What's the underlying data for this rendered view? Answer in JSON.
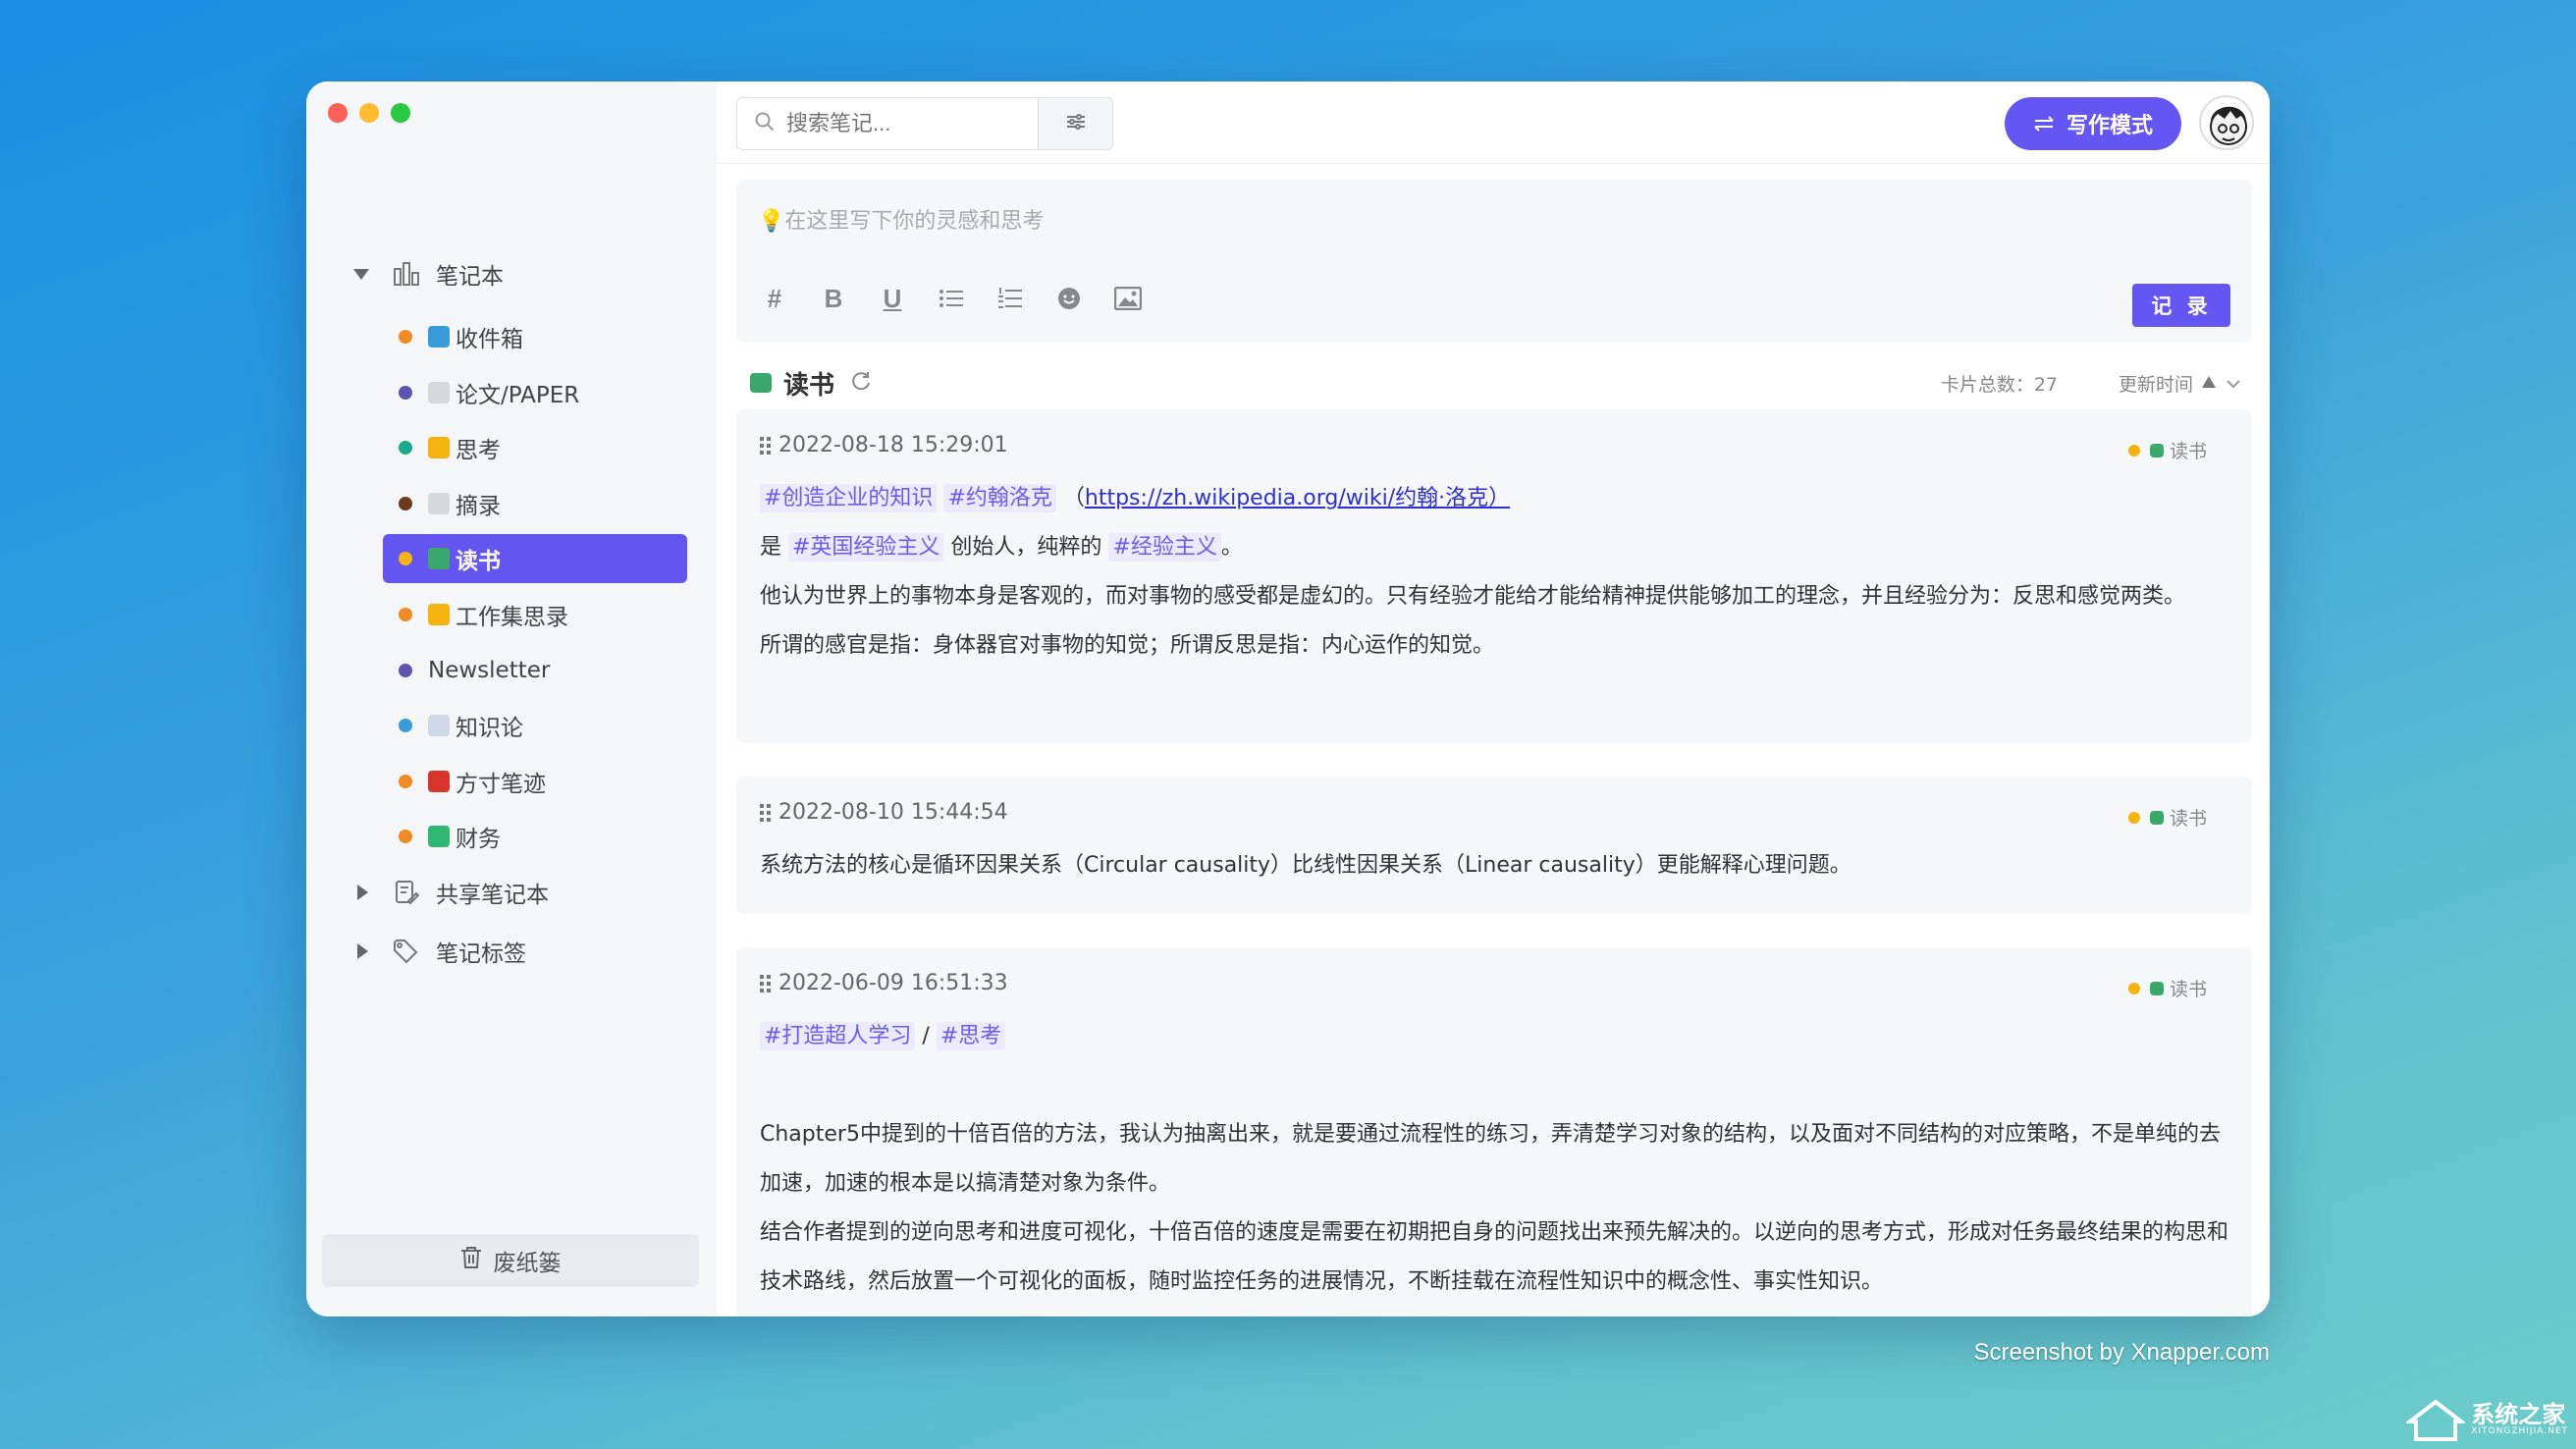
{
  "sidebar": {
    "root_label": "笔记本",
    "notebooks": [
      {
        "label": "收件箱",
        "dot": "#f08a24",
        "icon": "inbox-icon",
        "emoji_bg": "#3a9bd9",
        "active": false
      },
      {
        "label": "论文/PAPER",
        "dot": "#5b55b0",
        "icon": "document-icon",
        "emoji_bg": "#d8d8d8",
        "active": false
      },
      {
        "label": "思考",
        "dot": "#1aab8a",
        "icon": "thinking-face-icon",
        "emoji_bg": "#f5b30d",
        "active": false
      },
      {
        "label": "摘录",
        "dot": "#6b3a1f",
        "icon": "document-icon",
        "emoji_bg": "#d8d8d8",
        "active": false
      },
      {
        "label": "读书",
        "dot": "#f5b30d",
        "icon": "books-icon",
        "emoji_bg": "#3aa86b",
        "active": true
      },
      {
        "label": "工作集思录",
        "dot": "#f08a24",
        "icon": "thinking-face-icon",
        "emoji_bg": "#f5b30d",
        "active": false
      },
      {
        "label": "Newsletter",
        "dot": "#5b55b0",
        "icon": "",
        "emoji_bg": "",
        "active": false
      },
      {
        "label": "知识论",
        "dot": "#3a9bd9",
        "icon": "open-book-icon",
        "emoji_bg": "#cfd8e6",
        "active": false
      },
      {
        "label": "方寸笔迹",
        "dot": "#f08a24",
        "icon": "red-book-icon",
        "emoji_bg": "#d9342b",
        "active": false
      },
      {
        "label": "财务",
        "dot": "#f08a24",
        "icon": "chart-increasing-icon",
        "emoji_bg": "#2eb872",
        "active": false
      }
    ],
    "shared_label": "共享笔记本",
    "tags_label": "笔记标签",
    "trash_label": "废纸篓"
  },
  "topbar": {
    "search_placeholder": "搜索笔记...",
    "write_mode_label": "写作模式"
  },
  "editor": {
    "placeholder": "💡在这里写下你的灵感和思考",
    "record_label": "记 录"
  },
  "list": {
    "title": "读书",
    "count_label": "卡片总数：27",
    "sort_label": "更新时间"
  },
  "cards": [
    {
      "timestamp": "2022-08-18 15:29:01",
      "notebook": "读书",
      "tag1": "#创造企业的知识",
      "tag2": "#约翰洛克",
      "link_prefix": "（",
      "link": "https://zh.wikipedia.org/wiki/约翰·洛克）",
      "l2_a": "是 ",
      "l2_tag1": "#英国经验主义",
      "l2_b": " 创始人，纯粹的 ",
      "l2_tag2": "#经验主义",
      "l2_c": "。",
      "l3": "他认为世界上的事物本身是客观的，而对事物的感受都是虚幻的。只有经验才能给才能给精神提供能够加工的理念，并且经验分为：反思和感觉两类。",
      "l4": "所谓的感官是指：身体器官对事物的知觉；所谓反思是指：内心运作的知觉。"
    },
    {
      "timestamp": "2022-08-10 15:44:54",
      "notebook": "读书",
      "l1": "系统方法的核心是循环因果关系（Circular causality）比线性因果关系（Linear causality）更能解释心理问题。"
    },
    {
      "timestamp": "2022-06-09 16:51:33",
      "notebook": "读书",
      "tag1": "#打造超人学习",
      "sep": " / ",
      "tag2": "#思考",
      "l2": "Chapter5中提到的十倍百倍的方法，我认为抽离出来，就是要通过流程性的练习，弄清楚学习对象的结构，以及面对不同结构的对应策略，不是单纯的去加速，加速的根本是以搞清楚对象为条件。",
      "l3": "结合作者提到的逆向思考和进度可视化，十倍百倍的速度是需要在初期把自身的问题找出来预先解决的。以逆向的思考方式，形成对任务最终结果的构思和技术路线，然后放置一个可视化的面板，随时监控任务的进展情况，不断挂载在流程性知识中的概念性、事实性知识。"
    }
  ],
  "footer": {
    "credit": "Screenshot by Xnapper.com",
    "watermark": "系统之家",
    "watermark_sub": "XITONGZHIJIA.NET"
  },
  "colors": {
    "accent": "#6356f2",
    "tag_bg": "#eceaff",
    "tag_fg": "#6a5cf0"
  }
}
